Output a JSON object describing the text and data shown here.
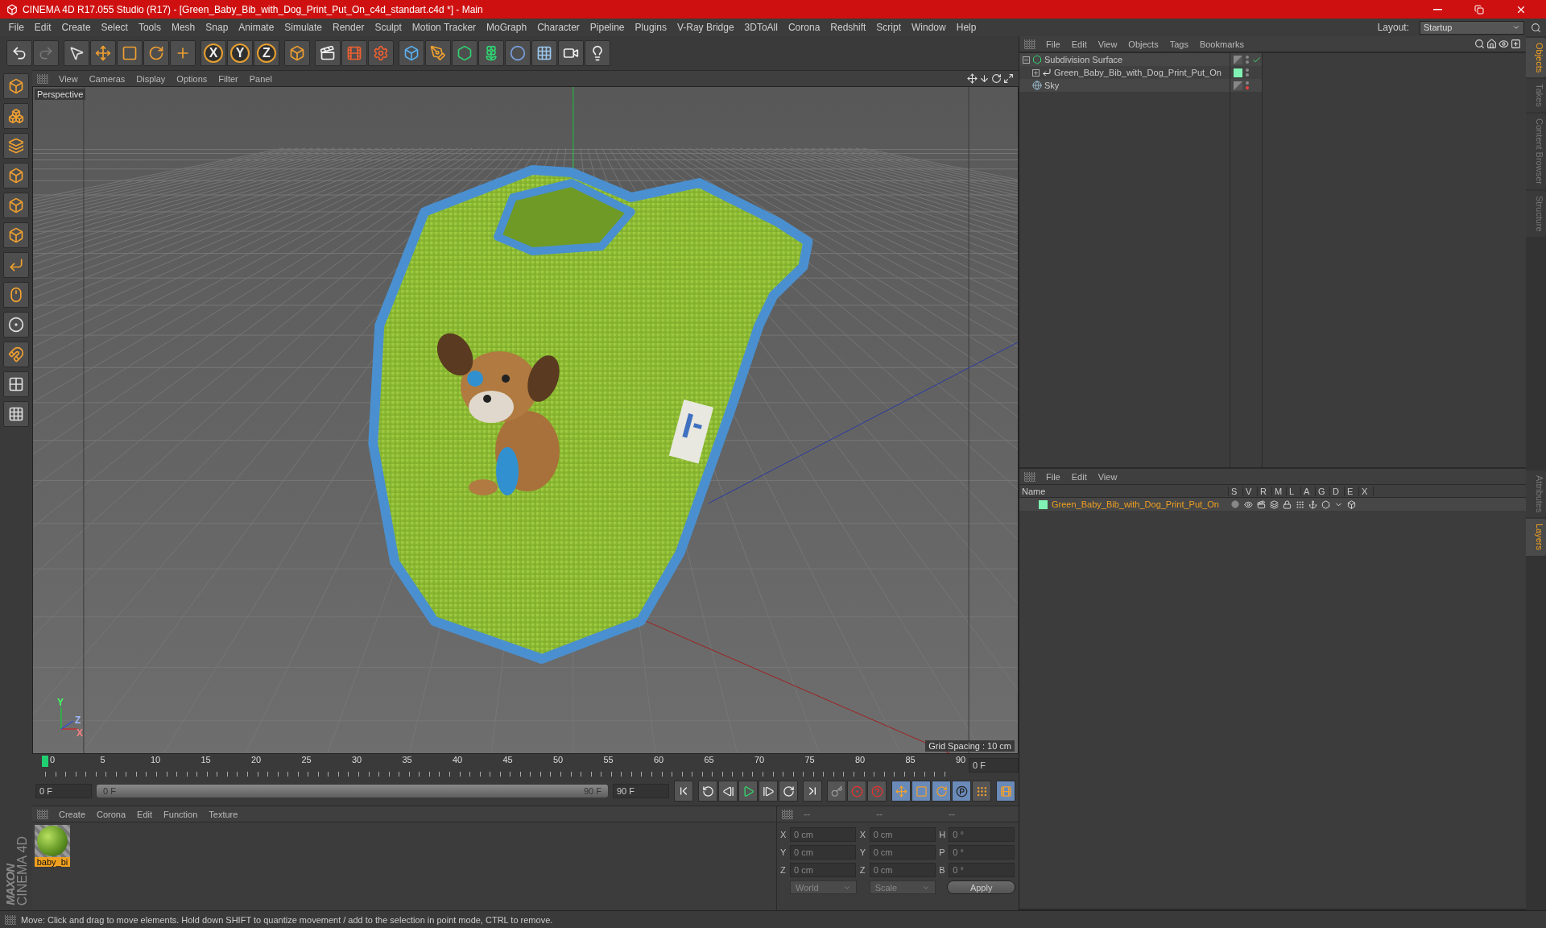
{
  "window": {
    "title": "CINEMA 4D R17.055 Studio (R17) - [Green_Baby_Bib_with_Dog_Print_Put_On_c4d_standart.c4d *] - Main"
  },
  "menu_bar": {
    "items": [
      "File",
      "Edit",
      "Create",
      "Select",
      "Tools",
      "Mesh",
      "Snap",
      "Animate",
      "Simulate",
      "Render",
      "Sculpt",
      "Motion Tracker",
      "MoGraph",
      "Character",
      "Pipeline",
      "Plugins",
      "V-Ray Bridge",
      "3DToAll",
      "Corona",
      "Redshift",
      "Script",
      "Window",
      "Help"
    ],
    "layout_label": "Layout:",
    "layout_value": "Startup"
  },
  "toolbar": {
    "axis_buttons": [
      "X",
      "Y",
      "Z"
    ]
  },
  "viewport": {
    "menu": [
      "View",
      "Cameras",
      "Display",
      "Options",
      "Filter",
      "Panel"
    ],
    "camera": "Perspective",
    "grid_spacing": "Grid Spacing : 10 cm",
    "axis_labels": [
      "Y",
      "Z",
      "X"
    ]
  },
  "object_manager": {
    "menu": [
      "File",
      "Edit",
      "View",
      "Objects",
      "Tags",
      "Bookmarks"
    ],
    "objects": [
      {
        "name": "Subdivision Surface",
        "kind": "generator",
        "expanded": true,
        "children": [
          {
            "name": "Green_Baby_Bib_with_Dog_Print_Put_On",
            "kind": "polygon",
            "expanded": false,
            "color": "#80f2b4"
          }
        ]
      },
      {
        "name": "Sky",
        "kind": "sky"
      }
    ]
  },
  "side_tabs_top": [
    {
      "label": "Objects",
      "selected": true
    },
    {
      "label": "Takes",
      "selected": false
    },
    {
      "label": "Content Browser",
      "selected": false
    },
    {
      "label": "Structure",
      "selected": false
    }
  ],
  "layer_manager": {
    "menu": [
      "File",
      "Edit",
      "View"
    ],
    "columns": [
      "Name",
      "S",
      "V",
      "R",
      "M",
      "L",
      "A",
      "G",
      "D",
      "E",
      "X"
    ],
    "layers": [
      {
        "name": "Green_Baby_Bib_with_Dog_Print_Put_On",
        "color": "#80f2b4",
        "selected": true
      }
    ]
  },
  "side_tabs_bottom": [
    {
      "label": "Attributes",
      "selected": false
    },
    {
      "label": "Layers",
      "selected": true
    }
  ],
  "timeline": {
    "ticks": [
      "0",
      "5",
      "10",
      "15",
      "20",
      "25",
      "30",
      "35",
      "40",
      "45",
      "50",
      "55",
      "60",
      "65",
      "70",
      "75",
      "80",
      "85",
      "90"
    ],
    "level": 0,
    "frame_field": "0 F",
    "start_field": "0 F",
    "range": {
      "start": "0 F",
      "end": "90 F",
      "level": 1
    },
    "end_field": "90 F"
  },
  "material_manager": {
    "menu": [
      "Create",
      "Corona",
      "Edit",
      "Function",
      "Texture"
    ],
    "materials": [
      {
        "name": "baby_bi",
        "selected": true
      }
    ]
  },
  "coordinates": {
    "headers": [
      "--",
      "--",
      "--"
    ],
    "rows": [
      [
        {
          "axis": "X",
          "value": "0 cm"
        },
        {
          "axis": "X",
          "value": "0 cm"
        },
        {
          "axis": "H",
          "value": "0 °"
        }
      ],
      [
        {
          "axis": "Y",
          "value": "0 cm"
        },
        {
          "axis": "Y",
          "value": "0 cm"
        },
        {
          "axis": "P",
          "value": "0 °"
        }
      ],
      [
        {
          "axis": "Z",
          "value": "0 cm"
        },
        {
          "axis": "Z",
          "value": "0 cm"
        },
        {
          "axis": "B",
          "value": "0 °"
        }
      ]
    ],
    "dropdowns": [
      "World",
      "Scale"
    ],
    "apply": "Apply"
  },
  "logo": {
    "brand": "MAXON",
    "product": "CINEMA 4D"
  },
  "status_bar": {
    "text": "Move: Click and drag to move elements. Hold down SHIFT to quantize movement / add to the selection in point mode, CTRL to remove."
  }
}
